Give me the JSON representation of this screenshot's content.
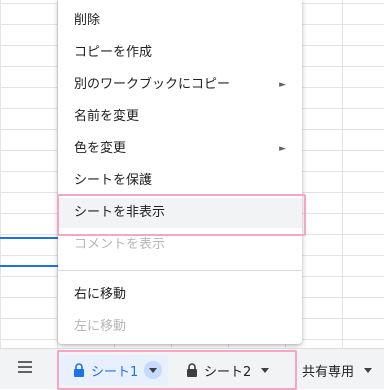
{
  "context_menu": {
    "items": [
      {
        "label": "削除",
        "disabled": false,
        "submenu": false
      },
      {
        "label": "コピーを作成",
        "disabled": false,
        "submenu": false
      },
      {
        "label": "別のワークブックにコピー",
        "disabled": false,
        "submenu": true
      },
      {
        "label": "名前を変更",
        "disabled": false,
        "submenu": false
      },
      {
        "label": "色を変更",
        "disabled": false,
        "submenu": true
      },
      {
        "label": "シートを保護",
        "disabled": false,
        "submenu": false
      },
      {
        "label": "シートを非表示",
        "disabled": false,
        "submenu": false,
        "selected": true
      },
      {
        "label": "コメントを表示",
        "disabled": true,
        "submenu": false
      },
      {
        "label": "右に移動",
        "disabled": false,
        "submenu": false
      },
      {
        "label": "左に移動",
        "disabled": true,
        "submenu": false
      }
    ],
    "submenu_arrow": "►"
  },
  "tabbar": {
    "menu_icon": "hamburger-icon",
    "tabs": [
      {
        "label": "シート1",
        "locked": true,
        "active": true
      },
      {
        "label": "シート2",
        "locked": true,
        "active": false
      }
    ],
    "shared_label": "共有専用"
  },
  "colors": {
    "accent": "#1a73e8",
    "highlight": "#f4a6c4",
    "active_tab_bg": "#e8f0fe"
  }
}
